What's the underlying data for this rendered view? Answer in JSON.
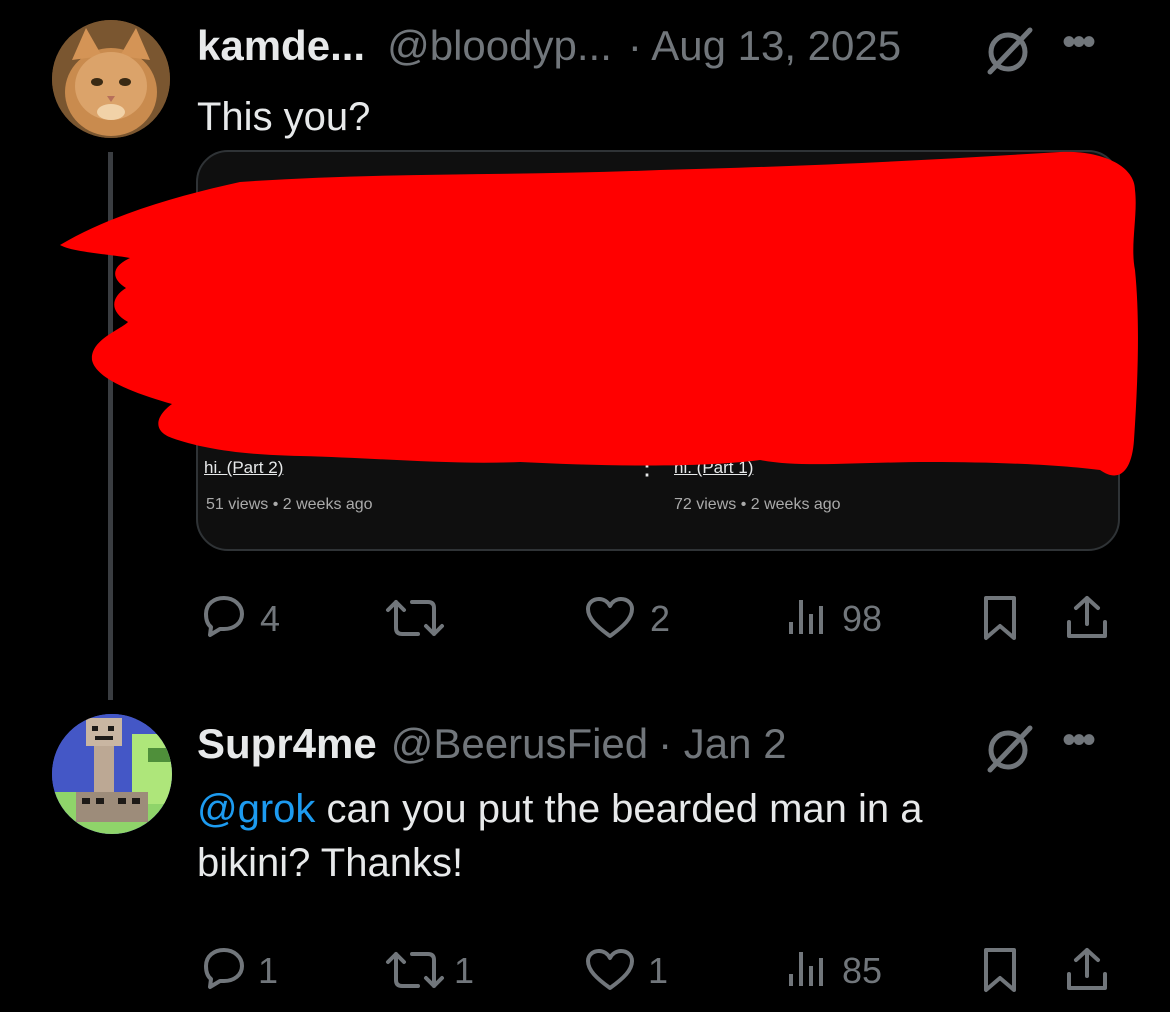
{
  "tweet1": {
    "display_name": "kamde...",
    "handle": "@bloodyp...",
    "date": "· Aug 13, 2025",
    "text": "This you?",
    "media": {
      "video_left": {
        "title": "hi. (Part 2)",
        "meta": "51 views • 2 weeks ago"
      },
      "video_right": {
        "title": "hi. (Part 1)",
        "meta": "72 views • 2 weeks ago"
      },
      "redaction_color": "#ff0000"
    },
    "actions": {
      "replies": "4",
      "reposts": "",
      "likes": "2",
      "views": "98"
    }
  },
  "tweet2": {
    "display_name": "Supr4me",
    "handle": "@BeerusFied",
    "date": "· Jan 2",
    "mention": "@grok",
    "text_line1": " can you put the bearded man in a",
    "text_line2": "bikini? Thanks!",
    "actions": {
      "replies": "1",
      "reposts": "1",
      "likes": "1",
      "views": "85"
    }
  },
  "icons": [
    "grok-icon",
    "more-icon",
    "reply-icon",
    "repost-icon",
    "like-icon",
    "views-icon",
    "bookmark-icon",
    "share-icon"
  ],
  "colors": {
    "background": "#000000",
    "text": "#e7e9ea",
    "muted": "#71767b",
    "link": "#1d9bf0"
  }
}
